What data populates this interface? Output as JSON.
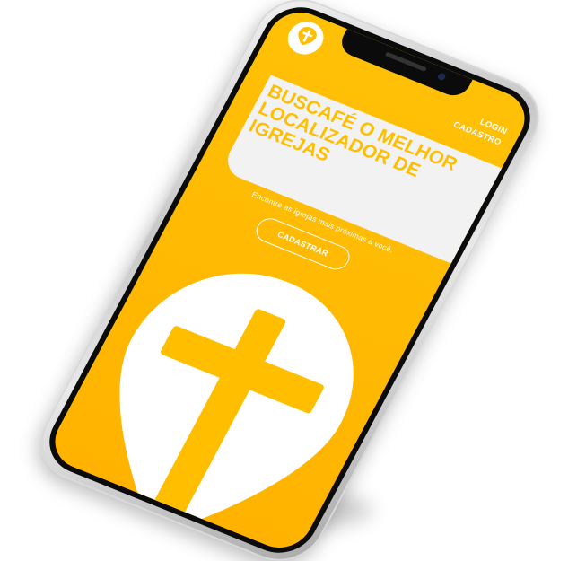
{
  "nav": {
    "login": "LOGIN",
    "signup": "CADASTRO"
  },
  "hero": {
    "title": "BUSCAFÉ O MELHOR LOCALIZADOR DE IGREJAS",
    "subtitle": "Encontre as igrejas mais próximas a você.",
    "cta": "CADASTRAR"
  },
  "icons": {
    "logo": "cross-pin-icon",
    "hero": "cross-icon"
  },
  "colors": {
    "accent": "#ffc107",
    "card": "#f2f2f2",
    "text_on_accent": "#ffffff"
  }
}
